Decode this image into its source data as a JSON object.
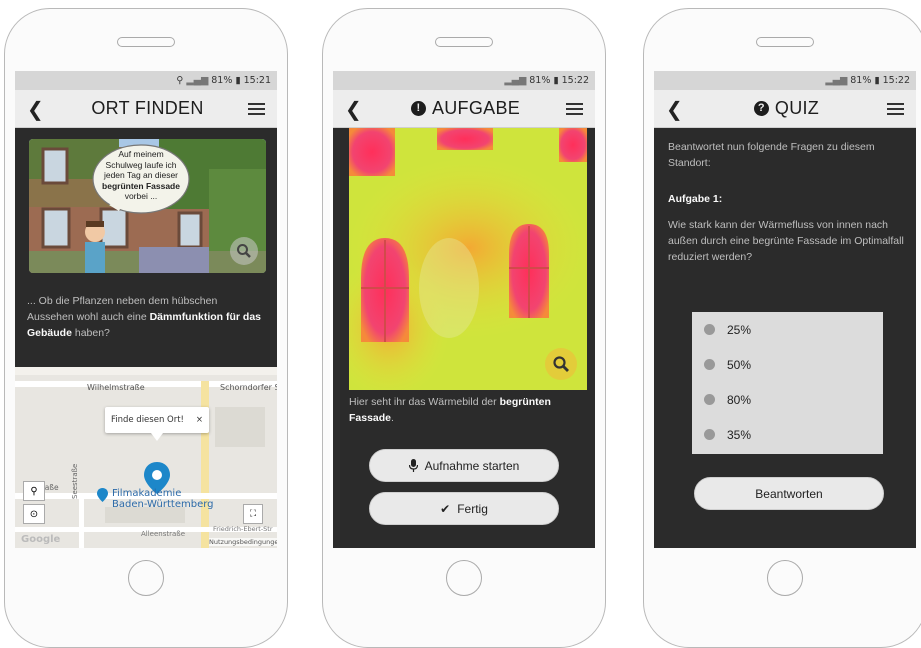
{
  "colors": {
    "screen_bg": "#2b2b2b",
    "appbar_bg": "#ededed",
    "statusbar_bg": "#d6d6d6",
    "button_bg": "#e9e9e9",
    "map_pin": "#1d87c9"
  },
  "phone1": {
    "status": {
      "battery": "81%",
      "time": "15:21"
    },
    "title": "ORT FINDEN",
    "speech": {
      "line1": "Auf meinem",
      "line2": "Schulweg laufe ich",
      "line3": "jeden Tag an dieser",
      "line4_bold": "begrünten Fassade",
      "line5": "vorbei ..."
    },
    "text_normal": "... Ob die Pflanzen neben dem hübschen Aussehen wohl auch eine ",
    "text_bold": "Dämmfunktion für das Gebäude",
    "text_end": " haben?",
    "map": {
      "street_top": "Wilhelmstraße",
      "street_right": "Schorndorfer Str",
      "street_left": "...estraße",
      "street_vertical": "Seestraße",
      "popup": "Finde diesen Ort!",
      "popup_close": "×",
      "poi_line1": "Filmakademie",
      "poi_line2": "Baden-Württemberg",
      "street_bottom": "Alleenstraße",
      "street_bottom_right": "Friedrich-Ebert-Str",
      "terms": "Nutzungsbedingungen",
      "google": "Google"
    }
  },
  "phone2": {
    "status": {
      "battery": "81%",
      "time": "15:22"
    },
    "title": "AUFGABE",
    "caption_normal": "Hier seht ihr das Wärmebild der ",
    "caption_bold": "begrünten Fassade",
    "caption_end": ".",
    "buttons": {
      "record": "Aufnahme starten",
      "done": "Fertig"
    }
  },
  "phone3": {
    "status": {
      "battery": "81%",
      "time": "15:22"
    },
    "title": "QUIZ",
    "intro": "Beantwortet nun folgende Fragen zu diesem Standort:",
    "task_label": "Aufgabe 1:",
    "question": "Wie stark kann der Wärmefluss von innen nach außen durch eine begrünte Fassade im Optimalfall reduziert werden?",
    "options": [
      "25%",
      "50%",
      "80%",
      "35%"
    ],
    "submit": "Beantworten"
  }
}
